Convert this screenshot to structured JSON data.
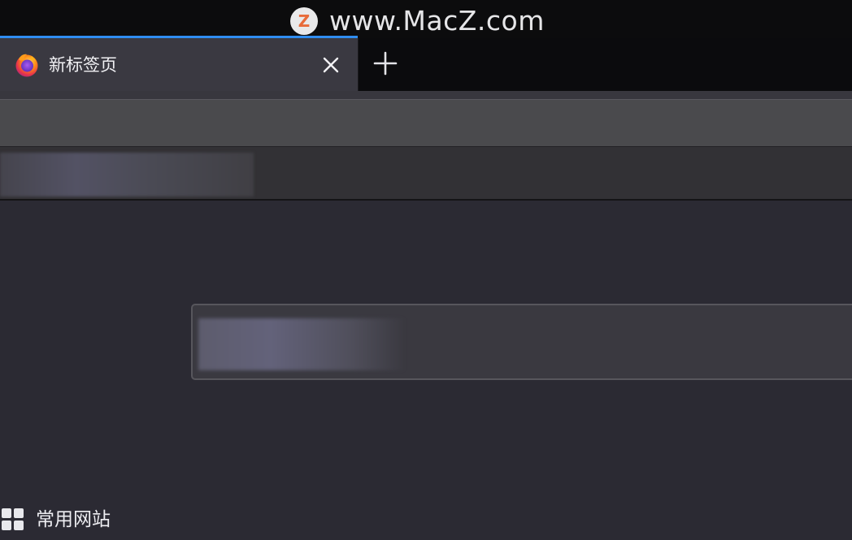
{
  "watermark": {
    "logo_letter": "Z",
    "text": "www.MacZ.com"
  },
  "tabs": [
    {
      "title": "新标签页",
      "favicon": "firefox-logo-icon",
      "close_icon": "close-icon"
    }
  ],
  "new_tab_icon": "plus-icon",
  "top_sites": {
    "icon": "grid-icon",
    "label": "常用网站"
  },
  "colors": {
    "accent": "#2f8df0",
    "tab_active_bg": "#3a3941",
    "page_bg": "#2b2a33",
    "watermark_logo": "#e86b3a"
  }
}
